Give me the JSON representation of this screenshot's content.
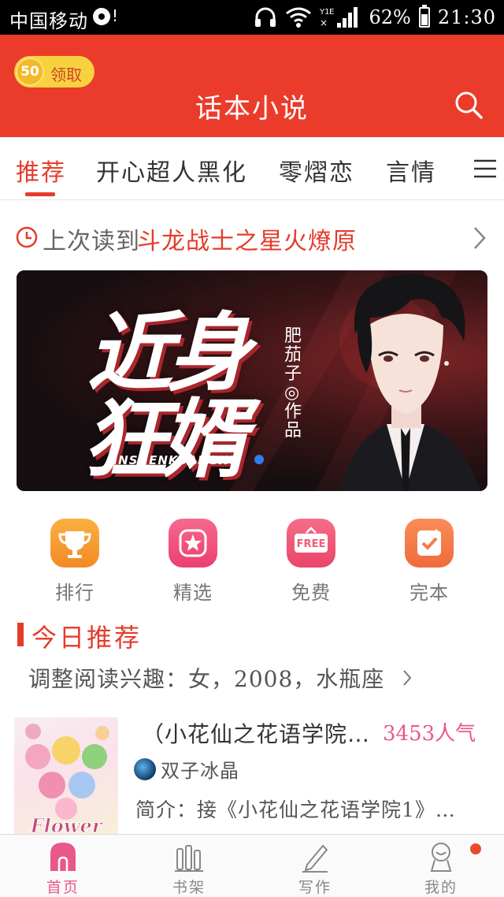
{
  "status_bar": {
    "carrier": "中国移动",
    "excl": "!",
    "battery": "62%",
    "time": "21:30"
  },
  "header": {
    "coin_value": "50",
    "coin_label": "领取",
    "title": "话本小说"
  },
  "tabs": [
    {
      "label": "推荐",
      "active": true
    },
    {
      "label": "开心超人黑化",
      "active": false
    },
    {
      "label": "零熠恋",
      "active": false
    },
    {
      "label": "言情",
      "active": false
    }
  ],
  "last_read": {
    "prefix": "上次读到",
    "title": "斗龙战士之星火燎原"
  },
  "banner": {
    "title_line1": "近身",
    "title_line2": "狂婿",
    "author": "肥茄子◎作品",
    "pinyin": "JINSHENKUANGXU"
  },
  "categories": [
    {
      "label": "排行",
      "icon": "trophy-icon",
      "color": "#f79a2e"
    },
    {
      "label": "精选",
      "icon": "star-icon",
      "color": "#f0527e"
    },
    {
      "label": "免费",
      "icon": "free-tag-icon",
      "color": "#ef5a78"
    },
    {
      "label": "完本",
      "icon": "check-icon",
      "color": "#f47a4a"
    }
  ],
  "today": {
    "title": "今日推荐",
    "subtitle": "调整阅读兴趣：女，2008，水瓶座"
  },
  "book": {
    "title": "（小花仙之花语学院…",
    "popularity": "3453人气",
    "author": "双子冰晶",
    "description": "简介：接《小花仙之花语学院1》…",
    "cover_text": "Flower"
  },
  "bottom_nav": [
    {
      "label": "首页",
      "icon": "home-icon",
      "active": true
    },
    {
      "label": "书架",
      "icon": "bookshelf-icon",
      "active": false
    },
    {
      "label": "写作",
      "icon": "pen-icon",
      "active": false
    },
    {
      "label": "我的",
      "icon": "profile-icon",
      "active": false
    }
  ],
  "colors": {
    "brand_red": "#ea3b2b",
    "accent_pink": "#e8588a",
    "coin_yellow": "#f7d23e"
  }
}
